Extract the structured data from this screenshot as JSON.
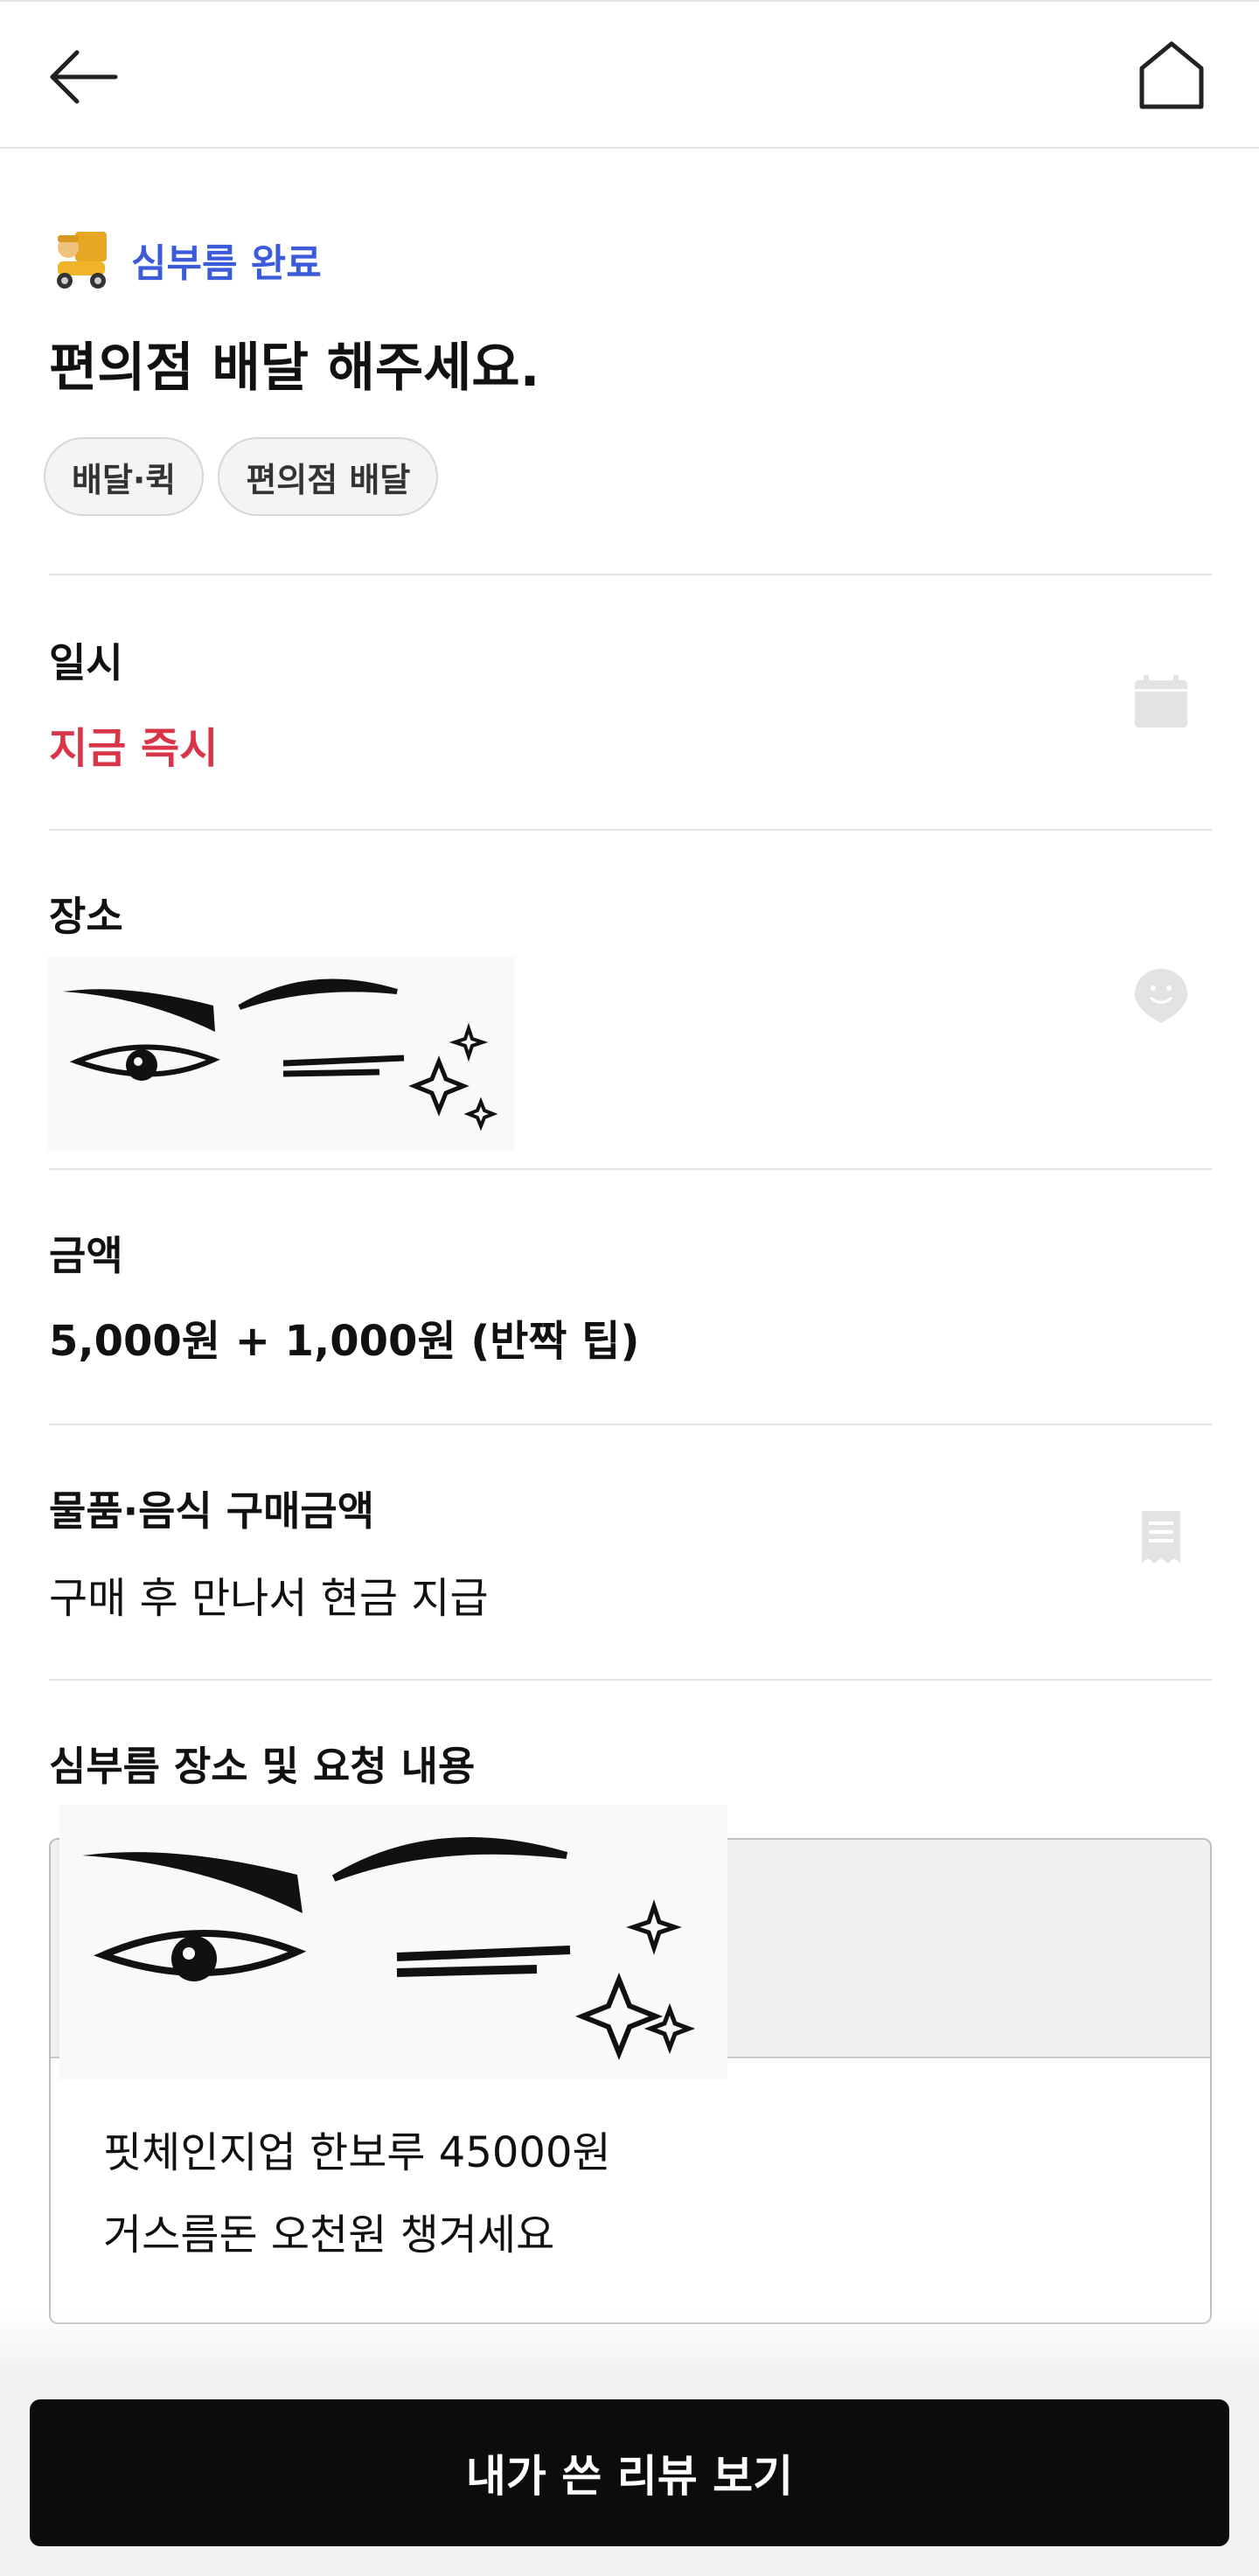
{
  "header": {
    "back_icon": "arrow-left-icon",
    "home_icon": "home-icon"
  },
  "status": {
    "mascot_icon": "delivery-mascot-icon",
    "label": "심부름 완료",
    "color": "#3b5bdb"
  },
  "title": "편의점 배달 해주세요.",
  "tags": [
    "배달·퀵",
    "편의점 배달"
  ],
  "sections": {
    "datetime": {
      "label": "일시",
      "value": "지금 즉시",
      "value_color": "#d93548",
      "icon": "calendar-icon"
    },
    "place": {
      "label": "장소",
      "icon": "location-pin-icon"
    },
    "amount": {
      "label": "금액",
      "value": "5,000원 + 1,000원 (반짝 팁)"
    },
    "purchase": {
      "label": "물품·음식 구매금액",
      "value": "구매 후 만나서 현금 지급",
      "icon": "receipt-icon"
    },
    "request": {
      "label": "심부름 장소 및 요청 내용",
      "lines": [
        "핏체인지업 한보루 45000원",
        "거스름돈 오천원 챙겨세요"
      ]
    }
  },
  "footer": {
    "button_label": "내가 쓴 리뷰 보기"
  }
}
